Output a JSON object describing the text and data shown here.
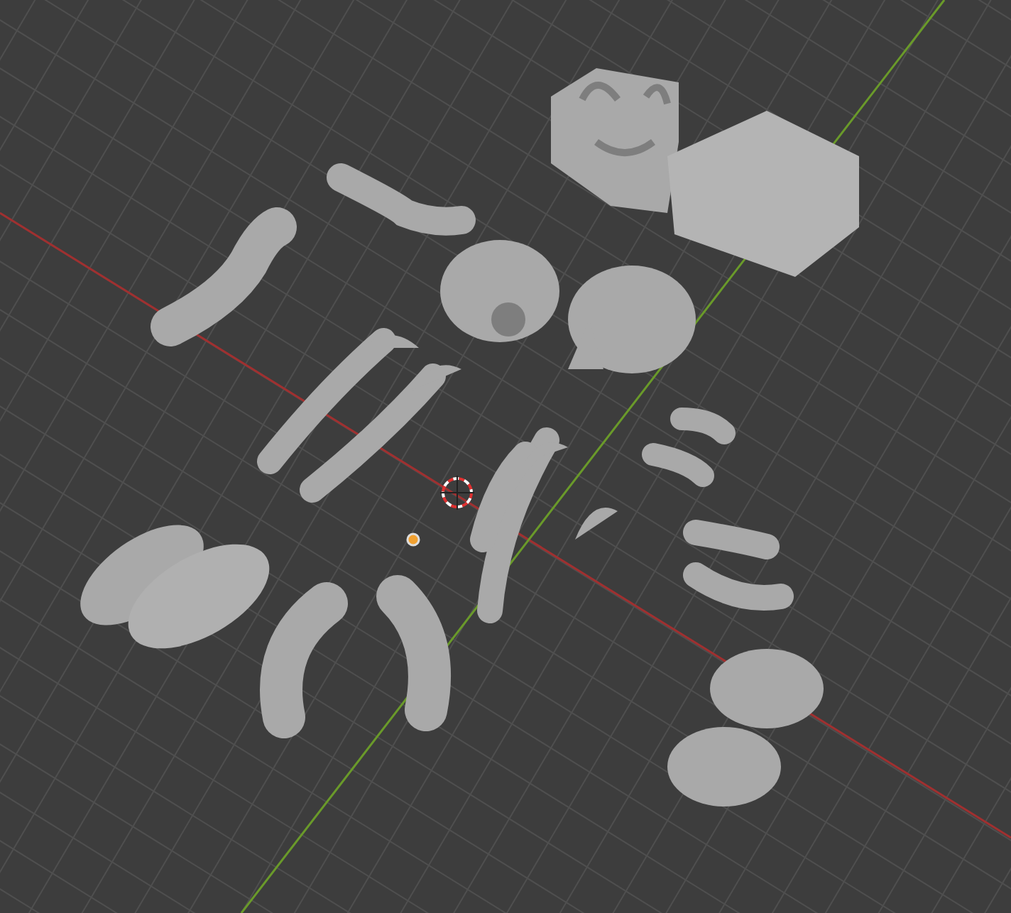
{
  "viewport": {
    "grid": true,
    "x_axis": true,
    "y_axis": true,
    "cursor_3d": true,
    "origin": true
  }
}
